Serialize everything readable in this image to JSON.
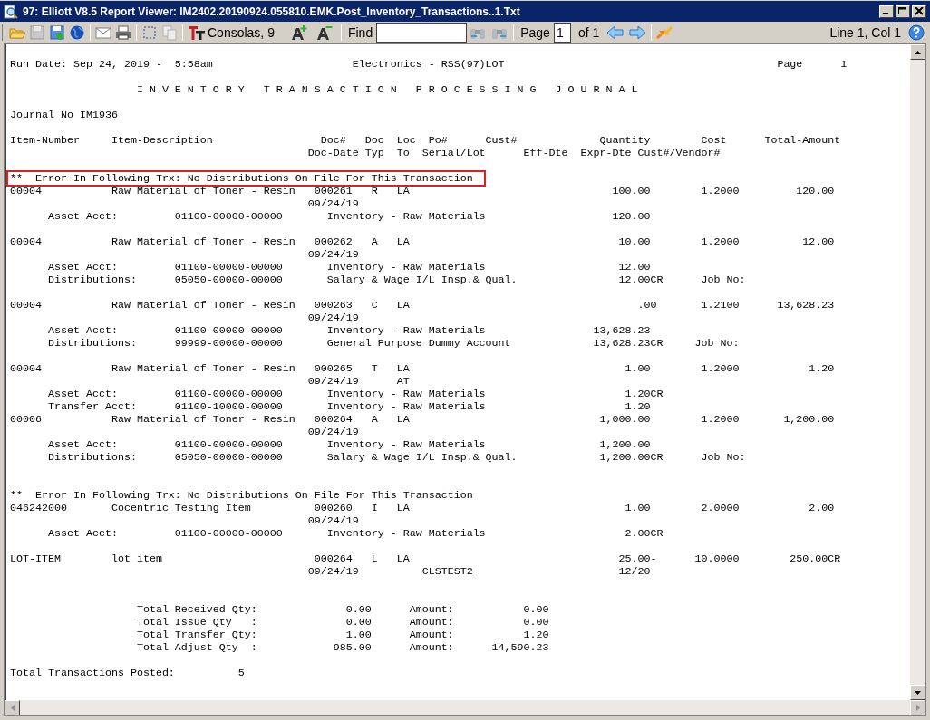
{
  "window": {
    "title": "97: Elliott V8.5 Report Viewer: IM2402.20190924.055810.EMK.Post_Inventory_Transactions..1.Txt"
  },
  "toolbar": {
    "font_label": "Consolas, 9",
    "find_label": "Find",
    "page_label": "Page",
    "page_value": "1",
    "page_of": "of 1",
    "position": "Line 1, Col 1"
  },
  "report": {
    "lines": [
      {
        "kind": "blank"
      },
      {
        "kind": "text",
        "text": "Run Date: Sep 24, 2019 -  5:58am                      Electronics - RSS(97)LOT                                           Page      1",
        "boxed": false
      },
      {
        "kind": "blank"
      },
      {
        "kind": "text",
        "text": "                    I N V E N T O R Y   T R A N S A C T I O N   P R O C E S S I N G   J O U R N A L",
        "boxed": false
      },
      {
        "kind": "blank"
      },
      {
        "kind": "text",
        "text": "Journal No IM1936",
        "boxed": false
      },
      {
        "kind": "blank"
      },
      {
        "kind": "text",
        "text": "Item-Number     Item-Description                 Doc#   Doc  Loc  Po#      Cust#             Quantity        Cost      Total-Amount",
        "boxed": false
      },
      {
        "kind": "text",
        "text": "                                               Doc-Date Typ  To  Serial/Lot      Eff-Dte  Expr-Dte Cust#/Vendor#",
        "boxed": false
      },
      {
        "kind": "blank"
      },
      {
        "kind": "text",
        "text": "**  Error In Following Trx: No Distributions On File For This Transaction",
        "boxed": true
      },
      {
        "kind": "text",
        "text": "00004           Raw Material of Toner - Resin   000261   R   LA                                100.00        1.2000         120.00",
        "boxed": false
      },
      {
        "kind": "text",
        "text": "                                               09/24/19",
        "boxed": false
      },
      {
        "kind": "text",
        "text": "      Asset Acct:         01100-00000-00000       Inventory - Raw Materials                    120.00",
        "boxed": false
      },
      {
        "kind": "blank"
      },
      {
        "kind": "text",
        "text": "00004           Raw Material of Toner - Resin   000262   A   LA                                 10.00        1.2000          12.00",
        "boxed": false
      },
      {
        "kind": "text",
        "text": "                                               09/24/19",
        "boxed": false
      },
      {
        "kind": "text",
        "text": "      Asset Acct:         01100-00000-00000       Inventory - Raw Materials                     12.00",
        "boxed": false
      },
      {
        "kind": "text",
        "text": "      Distributions:      05050-00000-00000       Salary & Wage I/L Insp.& Qual.                12.00CR      Job No:",
        "boxed": false
      },
      {
        "kind": "blank"
      },
      {
        "kind": "text",
        "text": "00004           Raw Material of Toner - Resin   000263   C   LA                                    .00       1.2100      13,628.23",
        "boxed": false
      },
      {
        "kind": "text",
        "text": "                                               09/24/19",
        "boxed": false
      },
      {
        "kind": "text",
        "text": "      Asset Acct:         01100-00000-00000       Inventory - Raw Materials                 13,628.23",
        "boxed": false
      },
      {
        "kind": "text",
        "text": "      Distributions:      99999-00000-00000       General Purpose Dummy Account             13,628.23CR     Job No:",
        "boxed": false
      },
      {
        "kind": "blank"
      },
      {
        "kind": "text",
        "text": "00004           Raw Material of Toner - Resin   000265   T   LA                                  1.00        1.2000           1.20",
        "boxed": false
      },
      {
        "kind": "text",
        "text": "                                               09/24/19      AT",
        "boxed": false
      },
      {
        "kind": "text",
        "text": "      Asset Acct:         01100-00000-00000       Inventory - Raw Materials                      1.20CR",
        "boxed": false
      },
      {
        "kind": "text",
        "text": "      Transfer Acct:      01100-10000-00000       Inventory - Raw Materials                      1.20",
        "boxed": false
      },
      {
        "kind": "text",
        "text": "00006           Raw Material of Toner - Resin   000264   A   LA                              1,000.00        1.2000       1,200.00",
        "boxed": false
      },
      {
        "kind": "text",
        "text": "                                               09/24/19",
        "boxed": false
      },
      {
        "kind": "text",
        "text": "      Asset Acct:         01100-00000-00000       Inventory - Raw Materials                  1,200.00",
        "boxed": false
      },
      {
        "kind": "text",
        "text": "      Distributions:      05050-00000-00000       Salary & Wage I/L Insp.& Qual.             1,200.00CR      Job No:",
        "boxed": false
      },
      {
        "kind": "blank"
      },
      {
        "kind": "blank"
      },
      {
        "kind": "text",
        "text": "**  Error In Following Trx: No Distributions On File For This Transaction",
        "boxed": false
      },
      {
        "kind": "text",
        "text": "046242000       Cocentric Testing Item          000260   I   LA                                  1.00        2.0000           2.00",
        "boxed": false
      },
      {
        "kind": "text",
        "text": "                                               09/24/19",
        "boxed": false
      },
      {
        "kind": "text",
        "text": "      Asset Acct:         01100-00000-00000       Inventory - Raw Materials                      2.00CR",
        "boxed": false
      },
      {
        "kind": "blank"
      },
      {
        "kind": "text",
        "text": "LOT-ITEM        lot item                        000264   L   LA                                 25.00-      10.0000        250.00CR",
        "boxed": false
      },
      {
        "kind": "text",
        "text": "                                               09/24/19          CLSTEST2                       12/20",
        "boxed": false
      },
      {
        "kind": "blank"
      },
      {
        "kind": "blank"
      },
      {
        "kind": "text",
        "text": "                    Total Received Qty:              0.00      Amount:           0.00",
        "boxed": false
      },
      {
        "kind": "text",
        "text": "                    Total Issue Qty   :              0.00      Amount:           0.00",
        "boxed": false
      },
      {
        "kind": "text",
        "text": "                    Total Transfer Qty:              1.00      Amount:           1.20",
        "boxed": false
      },
      {
        "kind": "text",
        "text": "                    Total Adjust Qty  :            985.00      Amount:      14,590.23",
        "boxed": false
      },
      {
        "kind": "blank"
      },
      {
        "kind": "text",
        "text": "Total Transactions Posted:          5",
        "boxed": false
      }
    ]
  }
}
